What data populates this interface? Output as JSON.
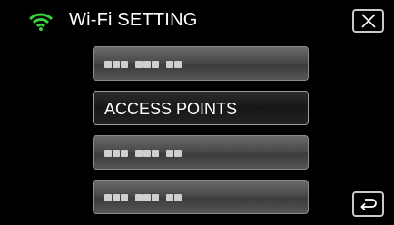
{
  "header": {
    "title": "Wi-Fi SETTING",
    "wifi_icon": "wifi-icon",
    "close_icon": "close-icon",
    "wifi_color": "#3ad13a"
  },
  "list": {
    "items": [
      {
        "label": "",
        "masked": true
      },
      {
        "label": "ACCESS POINTS",
        "masked": false,
        "selected": true
      },
      {
        "label": "",
        "masked": true
      },
      {
        "label": "",
        "masked": true
      }
    ]
  },
  "footer": {
    "back_icon": "return-icon"
  }
}
